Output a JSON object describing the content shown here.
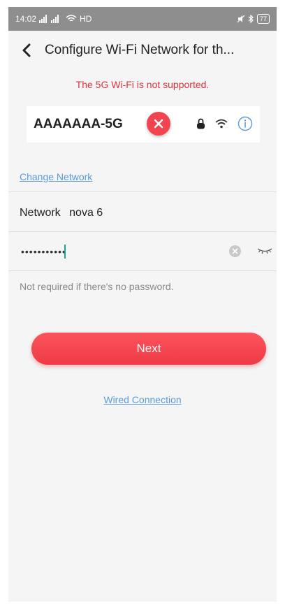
{
  "status_bar": {
    "time": "14:02",
    "signal_text": "ˢᴴ∥ ˢᴴ∥",
    "network_type": "HD",
    "battery": "77"
  },
  "app_bar": {
    "title": "Configure Wi-Fi Network for th..."
  },
  "warning": {
    "text": "The 5G Wi-Fi is not supported."
  },
  "wifi_card": {
    "ssid": "AAAAAAA-5G"
  },
  "change_network": {
    "label": "Change Network"
  },
  "network": {
    "label": "Network",
    "ssid": "nova 6"
  },
  "password": {
    "value": "•••••••••••"
  },
  "hint": {
    "text": "Not required if there's no password."
  },
  "next_button": {
    "label": "Next"
  },
  "wired_connection": {
    "label": "Wired Connection"
  },
  "colors": {
    "accent_red": "#ef3a45",
    "warning_red": "#e0323a",
    "link_blue": "#5a9bd8",
    "caret_teal": "#1aa39a"
  }
}
